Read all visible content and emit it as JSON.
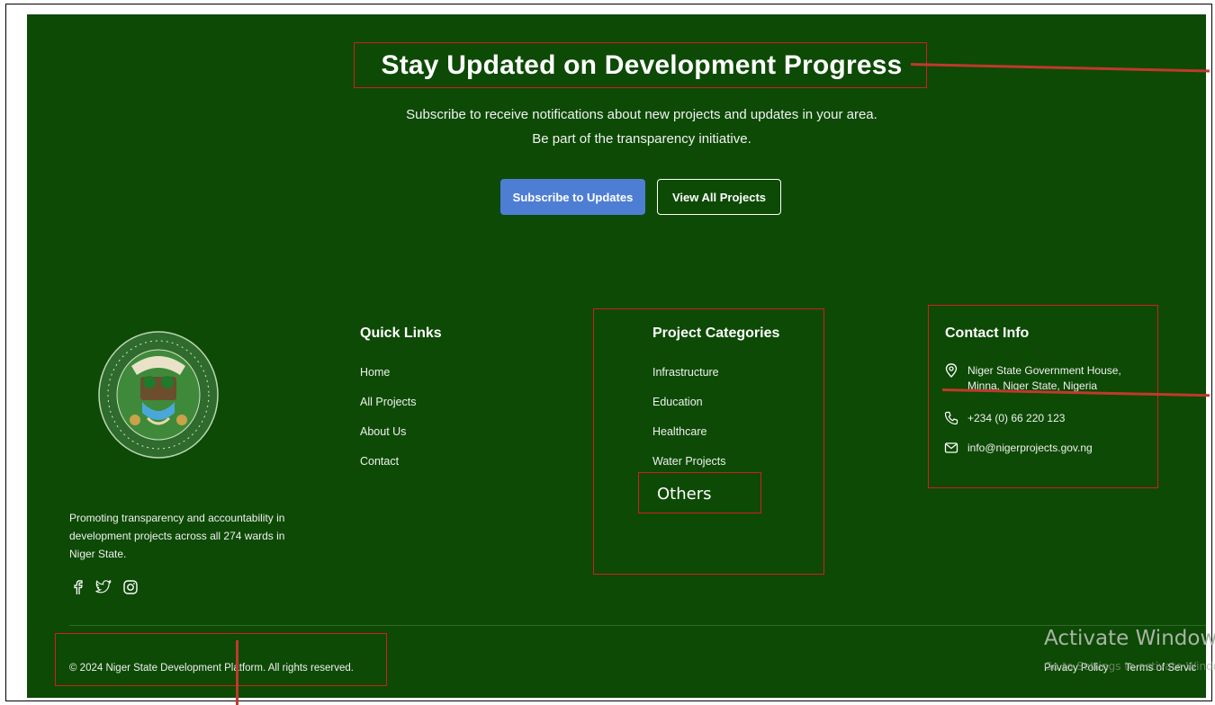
{
  "hero": {
    "title": "Stay Updated on Development Progress",
    "subtitle_line1": "Subscribe to receive notifications about new projects and updates in your area.",
    "subtitle_line2": "Be part of the transparency initiative.",
    "subscribe_label": "Subscribe to Updates",
    "view_all_label": "View All Projects"
  },
  "about": {
    "text": "Promoting transparency and accountability in development projects across all 274 wards in Niger State.",
    "social": [
      "facebook-icon",
      "twitter-icon",
      "instagram-icon"
    ]
  },
  "quick_links": {
    "title": "Quick Links",
    "items": [
      "Home",
      "All Projects",
      "About Us",
      "Contact"
    ]
  },
  "categories": {
    "title": "Project Categories",
    "items": [
      "Infrastructure",
      "Education",
      "Healthcare",
      "Water Projects"
    ],
    "others": "Others"
  },
  "contact": {
    "title": "Contact Info",
    "address_line1": "Niger State Government House,",
    "address_line2": "Minna, Niger State, Nigeria",
    "phone": "+234 (0) 66 220 123",
    "email": "info@nigerprojects.gov.ng"
  },
  "footer": {
    "copyright": "© 2024 Niger State Development Platform. All rights reserved.",
    "privacy": "Privacy Policy",
    "terms": "Terms of Servic"
  },
  "watermark": {
    "title": "Activate Windows",
    "subtitle": "Go to Settings to activate Windows."
  },
  "colors": {
    "background": "#0d4a05",
    "primary_button": "#4e7ed4",
    "annotation": "#d11f1f"
  }
}
